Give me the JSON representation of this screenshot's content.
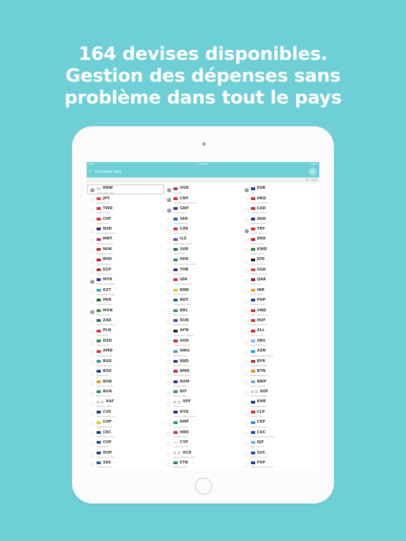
{
  "headline": {
    "line1": "164 devises disponibles.",
    "line2": "Gestion des dépenses sans",
    "line3": "problème dans tout le pays"
  },
  "device": {
    "status": {
      "left": "iPad",
      "center": "11:06 AM",
      "right": "100%"
    },
    "nav": {
      "back_glyph": "‹",
      "title": "Exchange Rate",
      "done_glyph": "✓"
    },
    "count_label": "8 / 164",
    "columns": [
      [
        {
          "code": "KRW",
          "name": "South Korean Won",
          "checked": true,
          "boxed": true,
          "flag": "#d6d6d6"
        },
        {
          "code": "JPY",
          "name": "Japanese Yen",
          "checked": false,
          "flag": "#e84040"
        },
        {
          "code": "TWD",
          "name": "Taiwan Dollar",
          "checked": false,
          "flag": "#d8303a"
        },
        {
          "code": "CHF",
          "name": "Swiss Franc",
          "checked": false,
          "flag": "#e4262a"
        },
        {
          "code": "NZD",
          "name": "New Zealand Dollar",
          "checked": false,
          "flag": "#27357a"
        },
        {
          "code": "MNT",
          "name": "Mongolian Tugrik",
          "checked": false,
          "flag": "#c63140"
        },
        {
          "code": "NOK",
          "name": "Norwegian Krone",
          "checked": false,
          "flag": "#c8283a"
        },
        {
          "code": "BHD",
          "name": "Bahraini Dinar",
          "checked": false,
          "flag": "#ce1126"
        },
        {
          "code": "EGP",
          "name": "Egyptian Pound",
          "checked": false,
          "flag": "#b0282e"
        },
        {
          "code": "MYR",
          "name": "Malaysian Ringgit",
          "checked": true,
          "flag": "#213a8f"
        },
        {
          "code": "KZT",
          "name": "Kazakhstani Tenge",
          "checked": false,
          "flag": "#2aa6c9"
        },
        {
          "code": "PKR",
          "name": "Pakistani Rupee",
          "checked": false,
          "flag": "#1e6b32"
        },
        {
          "code": "MXN",
          "name": "Mexican Peso",
          "checked": true,
          "flag": "#3a8a45"
        },
        {
          "code": "ZAR",
          "name": "South African Rand",
          "checked": false,
          "flag": "#1e7a3c"
        },
        {
          "code": "PLN",
          "name": "Polish Zloty",
          "checked": false,
          "flag": "#e02840"
        },
        {
          "code": "DZD",
          "name": "Algerian Dinar",
          "checked": false,
          "flag": "#2e8b44"
        },
        {
          "code": "AMD",
          "name": "Armenian Dram",
          "checked": false,
          "flag": "#d43838"
        },
        {
          "code": "BSD",
          "name": "Bahamian Dollar",
          "checked": false,
          "flag": "#1a9fc0"
        },
        {
          "code": "BZD",
          "name": "Belize Dollar",
          "checked": false,
          "flag": "#1c3d96"
        },
        {
          "code": "BOB",
          "name": "Bolivian Boliviano",
          "checked": false,
          "flag": "#d9a31f"
        },
        {
          "code": "BGN",
          "name": "Bulgarian Lev",
          "checked": false,
          "flag": "#2e8b50"
        },
        {
          "code": "XAF",
          "name": "CFA Franc BEAC",
          "checked": false,
          "flag": "#cfcfcf",
          "double": true
        },
        {
          "code": "CVE",
          "name": "Cape Verde Escudo",
          "checked": false,
          "flag": "#1f3b8c"
        },
        {
          "code": "COP",
          "name": "Colombian Peso",
          "checked": false,
          "flag": "#f0c11a"
        },
        {
          "code": "CRC",
          "name": "Costa Rican Colon",
          "checked": false,
          "flag": "#1d3a8f"
        },
        {
          "code": "CUP",
          "name": "Cuban Peso",
          "checked": false,
          "flag": "#1e4da1"
        },
        {
          "code": "DOP",
          "name": "Dominican R. Peso",
          "checked": false,
          "flag": "#1b3c8c"
        },
        {
          "code": "SEK",
          "name": "Swedish Krona",
          "checked": false,
          "flag": "#1f5fa6"
        }
      ],
      [
        {
          "code": "USD",
          "name": "US Dollar",
          "checked": true,
          "flag": "#b73a46"
        },
        {
          "code": "CNY",
          "name": "Chinese Yuan Renminbi",
          "checked": true,
          "flag": "#de2a2a"
        },
        {
          "code": "GBP",
          "name": "British Pound",
          "checked": true,
          "flag": "#27407d"
        },
        {
          "code": "SEK",
          "name": "Swedish Krona",
          "checked": false,
          "flag": "#2463a8"
        },
        {
          "code": "CZK",
          "name": "Czech Koruna",
          "checked": false,
          "flag": "#c9353e"
        },
        {
          "code": "ILS",
          "name": "Israeli New Shekel",
          "checked": false,
          "flag": "#3b62b8"
        },
        {
          "code": "SAR",
          "name": "Saudi Riyal",
          "checked": false,
          "flag": "#1f7a3a"
        },
        {
          "code": "AED",
          "name": "Utd. Arab Emir. Dirham",
          "checked": false,
          "flag": "#2f8c45"
        },
        {
          "code": "THB",
          "name": "Thai Baht",
          "checked": false,
          "flag": "#2b3a80"
        },
        {
          "code": "IDR",
          "name": "Indonesian Rupiah",
          "checked": false,
          "flag": "#d32f2f"
        },
        {
          "code": "BND",
          "name": "Brunei Dollar",
          "checked": false,
          "flag": "#e5c520"
        },
        {
          "code": "BDT",
          "name": "Bangladeshi Taka",
          "checked": false,
          "flag": "#1e6a3d"
        },
        {
          "code": "BRL",
          "name": "Brazilian Real",
          "checked": false,
          "flag": "#2a9a4a"
        },
        {
          "code": "RUB",
          "name": "Russian Rouble",
          "checked": false,
          "flag": "#2f4fa8"
        },
        {
          "code": "AFN",
          "name": "Afghanistan Afghani",
          "checked": false,
          "flag": "#1e1e1e"
        },
        {
          "code": "AOA",
          "name": "Angolan Kwanza",
          "checked": false,
          "flag": "#c8202a"
        },
        {
          "code": "AWG",
          "name": "Aruban Florin",
          "checked": false,
          "flag": "#4b92d0"
        },
        {
          "code": "BBD",
          "name": "Barbados Dollar",
          "checked": false,
          "flag": "#1f3c94"
        },
        {
          "code": "BMD",
          "name": "Bermudian Dollar",
          "checked": false,
          "flag": "#c02a32"
        },
        {
          "code": "BAM",
          "name": "Bosnian Mark",
          "checked": false,
          "flag": "#1e3a8e"
        },
        {
          "code": "BIF",
          "name": "Burundi Franc",
          "checked": false,
          "flag": "#2a9848"
        },
        {
          "code": "XPF",
          "name": "CFP Franc",
          "checked": false,
          "flag": "#cfcfcf",
          "double": true
        },
        {
          "code": "KYD",
          "name": "Cayman Islands Dollar",
          "checked": false,
          "flag": "#1c2f7c"
        },
        {
          "code": "KMF",
          "name": "Comoros Franc",
          "checked": false,
          "flag": "#2e9a4b"
        },
        {
          "code": "HRK",
          "name": "Croatian Kuna",
          "checked": false,
          "flag": "#c8303c"
        },
        {
          "code": "CYP",
          "name": "Cyprus Pound",
          "checked": false,
          "flag": "#e8e8e8"
        },
        {
          "code": "XCD",
          "name": "East Caribbean Dollar",
          "checked": false,
          "flag": "#cfcfcf",
          "double": true
        },
        {
          "code": "ETB",
          "name": "Ethiopian Birr",
          "checked": false,
          "flag": "#2a8a3a"
        }
      ],
      [
        {
          "code": "EUR",
          "name": "Euro",
          "checked": true,
          "flag": "#1f3d99"
        },
        {
          "code": "HKD",
          "name": "Hong Kong Dollar",
          "checked": false,
          "flag": "#d52b2b"
        },
        {
          "code": "CAD",
          "name": "Canadian Dollar",
          "checked": false,
          "flag": "#d8282c"
        },
        {
          "code": "AUD",
          "name": "Australian Dollar",
          "checked": false,
          "flag": "#233a80"
        },
        {
          "code": "TRY",
          "name": "Turkish New Lira",
          "checked": true,
          "flag": "#d82a2a"
        },
        {
          "code": "DKK",
          "name": "Danish Krone",
          "checked": false,
          "flag": "#c8202e"
        },
        {
          "code": "KWD",
          "name": "Kuwaiti Dinar",
          "checked": false,
          "flag": "#2a8a44"
        },
        {
          "code": "JOD",
          "name": "Jordanian Dinar",
          "checked": false,
          "flag": "#1e1e1e"
        },
        {
          "code": "SGD",
          "name": "Singapore Dollar",
          "checked": false,
          "flag": "#e03a3a"
        },
        {
          "code": "QAR",
          "name": "Qatari Rial",
          "checked": false,
          "flag": "#8a1d3c"
        },
        {
          "code": "INR",
          "name": "Indian Rupee",
          "checked": false,
          "flag": "#f09a2e"
        },
        {
          "code": "PHP",
          "name": "Philippine Peso",
          "checked": false,
          "flag": "#1f3a9a"
        },
        {
          "code": "VND",
          "name": "Vietnamese Dong",
          "checked": false,
          "flag": "#d62a2a"
        },
        {
          "code": "HUF",
          "name": "Hungarian Forint",
          "checked": false,
          "flag": "#c43a3a"
        },
        {
          "code": "ALL",
          "name": "Albanian Lek",
          "checked": false,
          "flag": "#d4202a"
        },
        {
          "code": "ARS",
          "name": "Argentine Peso",
          "checked": false,
          "flag": "#7db8e0"
        },
        {
          "code": "AZN",
          "name": "Azerbaijan New Manat",
          "checked": false,
          "flag": "#2aa0d0"
        },
        {
          "code": "BYR",
          "name": "Belarusian Ruble",
          "checked": false,
          "flag": "#c72a32"
        },
        {
          "code": "BTN",
          "name": "Bhutan Ngultrum",
          "checked": false,
          "flag": "#f28a22"
        },
        {
          "code": "BWP",
          "name": "Botswana Pula",
          "checked": false,
          "flag": "#6aaedc"
        },
        {
          "code": "XOF",
          "name": "CFA Franc BCEAO",
          "checked": false,
          "flag": "#cfcfcf",
          "double": true
        },
        {
          "code": "KHR",
          "name": "Cambodian Riel",
          "checked": false,
          "flag": "#1e3a8f"
        },
        {
          "code": "CLP",
          "name": "Chilean Peso",
          "checked": false,
          "flag": "#d32f2f"
        },
        {
          "code": "CDF",
          "name": "Congolese Franc",
          "checked": false,
          "flag": "#3a8ad0"
        },
        {
          "code": "CUC",
          "name": "Cuban Convertible Peso",
          "checked": false,
          "flag": "#1e4da1"
        },
        {
          "code": "DJF",
          "name": "Djibouti Franc",
          "checked": false,
          "flag": "#6ab8e0"
        },
        {
          "code": "SVC",
          "name": "El Salvador Colon",
          "checked": false,
          "flag": "#1f4da8"
        },
        {
          "code": "FKP",
          "name": "Falkland Islands Pound",
          "checked": false,
          "flag": "#1f3a8a"
        }
      ]
    ]
  }
}
